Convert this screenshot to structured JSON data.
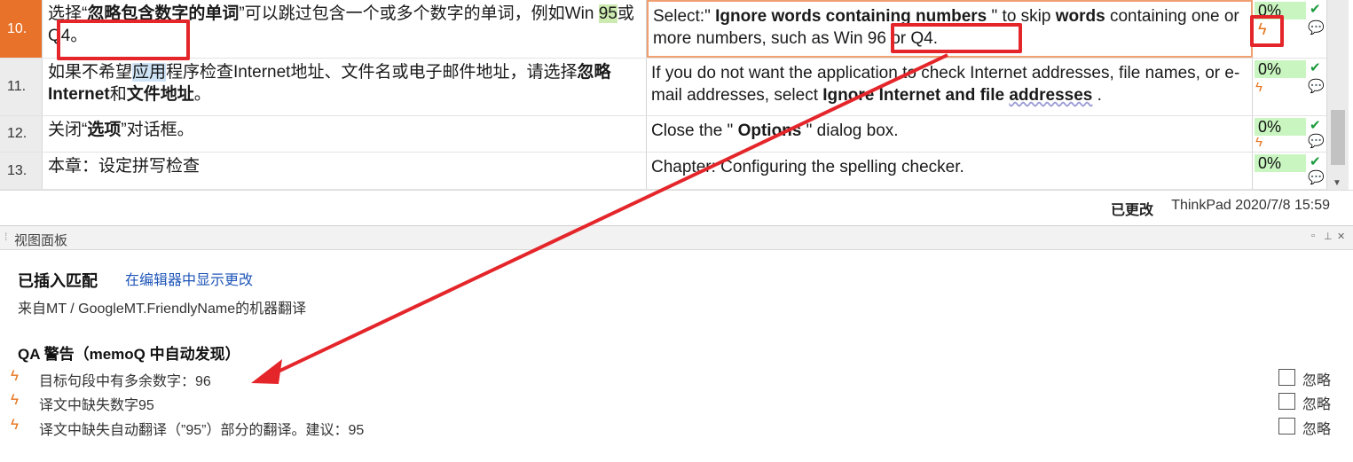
{
  "segments": [
    {
      "num": "10.",
      "source_parts": [
        "选择“",
        "忽略包含数字的单词",
        "”可以跳过包含一个或多个数字的单词，例如",
        "Win ",
        "95",
        "或Q4。"
      ],
      "target_parts": [
        "Select:\" ",
        "Ignore words containing numbers",
        " \" to skip ",
        "words",
        " containing one or more numbers, such as Win 96 or Q4."
      ],
      "percent": "0%"
    },
    {
      "num": "11.",
      "source_parts": [
        "如果不希望",
        "应用",
        "程序检查Internet地址、文件名或电子邮件地址，请选择",
        "忽略",
        "Internet",
        "和",
        "文件地址",
        "。"
      ],
      "target_parts": [
        "If you do not want the application to check Internet addresses, file names, or e-mail addresses, select ",
        "Ignore Internet and file ",
        "addresses",
        " ."
      ],
      "percent": "0%"
    },
    {
      "num": "12.",
      "source_parts": [
        "关闭“",
        "选项",
        "”对话框。"
      ],
      "target_parts": [
        "Close the \" ",
        "Options",
        " \" dialog box."
      ],
      "percent": "0%"
    },
    {
      "num": "13.",
      "source_parts": [
        "本章：设定拼写检查"
      ],
      "target_parts": [
        "Chapter: Configuring the spelling checker."
      ],
      "percent": "0%"
    }
  ],
  "status": {
    "changed": "已更改",
    "user_date": "ThinkPad 2020/7/8 15:59"
  },
  "pane": {
    "title": "视图面板",
    "inserted_match": "已插入匹配",
    "show_changes_link": "在编辑器中显示更改",
    "mt_source": "来自MT / GoogleMT.FriendlyName的机器翻译",
    "qa_title": "QA 警告（memoQ 中自动发现）",
    "qa_items": [
      {
        "text": "目标句段中有多余数字：96",
        "ignore": "忽略"
      },
      {
        "text": "译文中缺失数字95",
        "ignore": "忽略"
      },
      {
        "text": "译文中缺失自动翻译（”95”）部分的翻译。建议：95",
        "ignore": "忽略"
      }
    ]
  },
  "icons": {
    "warning": "lightning-warning-icon",
    "check": "check-icon",
    "comment": "comment-bubble-icon"
  },
  "colors": {
    "active_row_number": "#e8722a",
    "match_percent_bg": "#c8f5c0",
    "annotation_red": "#e4262b",
    "link_blue": "#1f56b8"
  }
}
